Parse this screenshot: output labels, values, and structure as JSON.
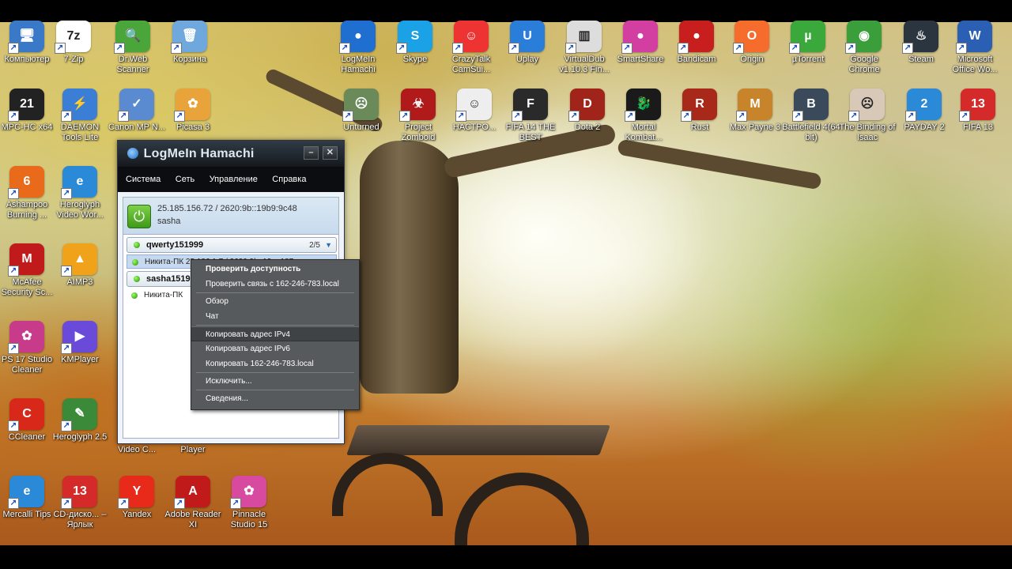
{
  "desktop_icons": [
    {
      "label": "Компьютер",
      "icon": "computer-icon",
      "color": "#3a78c8",
      "glyph": "🖥"
    },
    {
      "label": "7-Zip",
      "icon": "7zip-icon",
      "color": "#ffffff",
      "glyph": "7z"
    },
    {
      "label": "Dr.Web Scanner",
      "icon": "drweb-icon",
      "color": "#4aa53a",
      "glyph": "🔍"
    },
    {
      "label": "Корзина",
      "icon": "recycle-bin-icon",
      "color": "#6fa8dc",
      "glyph": "🗑"
    },
    {
      "label": "LogMeIn Hamachi",
      "icon": "hamachi-icon",
      "color": "#1f6fd1",
      "glyph": "●"
    },
    {
      "label": "Skype",
      "icon": "skype-icon",
      "color": "#1aa1e6",
      "glyph": "S"
    },
    {
      "label": "CrazyTalk CamSui...",
      "icon": "crazytalk-icon",
      "color": "#e33",
      "glyph": "☺"
    },
    {
      "label": "Uplay",
      "icon": "uplay-icon",
      "color": "#2a7ed9",
      "glyph": "U"
    },
    {
      "label": "VirtualDub v1.10.3 Fin...",
      "icon": "virtualdub-icon",
      "color": "#dddddd",
      "glyph": "▥"
    },
    {
      "label": "SmartShare",
      "icon": "smartshare-icon",
      "color": "#d33fa0",
      "glyph": "●"
    },
    {
      "label": "Bandicam",
      "icon": "bandicam-icon",
      "color": "#c81e1e",
      "glyph": "●"
    },
    {
      "label": "Origin",
      "icon": "origin-icon",
      "color": "#f56c2d",
      "glyph": "O"
    },
    {
      "label": "µTorrent",
      "icon": "utorrent-icon",
      "color": "#3aa83a",
      "glyph": "µ"
    },
    {
      "label": "Google Chrome",
      "icon": "chrome-icon",
      "color": "#3a9e3a",
      "glyph": "◉"
    },
    {
      "label": "Steam",
      "icon": "steam-icon",
      "color": "#2b3540",
      "glyph": "♨"
    },
    {
      "label": "Microsoft Office Wo...",
      "icon": "word-icon",
      "color": "#2b5fb4",
      "glyph": "W"
    },
    {
      "label": "MPC-HC x64",
      "icon": "mpc-icon",
      "color": "#222222",
      "glyph": "21"
    },
    {
      "label": "DAEMON Tools Lite",
      "icon": "daemon-tools-icon",
      "color": "#3a7ed6",
      "glyph": "⚡"
    },
    {
      "label": "Canon MP N...",
      "icon": "canon-icon",
      "color": "#5a8ad0",
      "glyph": "✓"
    },
    {
      "label": "Picasa 3",
      "icon": "picasa-icon",
      "color": "#e8a43a",
      "glyph": "✿"
    },
    {
      "label": "Unturned",
      "icon": "unturned-icon",
      "color": "#6a8a5a",
      "glyph": "☹"
    },
    {
      "label": "Project Zomboid",
      "icon": "zomboid-icon",
      "color": "#b01a1a",
      "glyph": "☣"
    },
    {
      "label": "НАСТРО...",
      "icon": "settings-app-icon",
      "color": "#eeeeee",
      "glyph": "☺"
    },
    {
      "label": "FIFA 14 THE BEST",
      "icon": "fifa14-icon",
      "color": "#2a2a2a",
      "glyph": "F"
    },
    {
      "label": "Dota 2",
      "icon": "dota2-icon",
      "color": "#a0241a",
      "glyph": "D"
    },
    {
      "label": "Mortal Kombat...",
      "icon": "mortal-kombat-icon",
      "color": "#1a1a1a",
      "glyph": "🐉"
    },
    {
      "label": "Rust",
      "icon": "rust-icon",
      "color": "#a8281a",
      "glyph": "R"
    },
    {
      "label": "Max Payne 3",
      "icon": "max-payne-icon",
      "color": "#c8842a",
      "glyph": "M"
    },
    {
      "label": "Battlefield 4(64 bit)",
      "icon": "battlefield-icon",
      "color": "#3a4a5a",
      "glyph": "B"
    },
    {
      "label": "The Binding of Isaac",
      "icon": "isaac-icon",
      "color": "#d8c8b8",
      "glyph": "☹"
    },
    {
      "label": "PAYDAY 2",
      "icon": "payday-icon",
      "color": "#2a8ad8",
      "glyph": "2"
    },
    {
      "label": "FIFA 13",
      "icon": "fifa13-icon",
      "color": "#d52a2a",
      "glyph": "13"
    },
    {
      "label": "Ashampoo Burning ...",
      "icon": "ashampoo-icon",
      "color": "#e86a1a",
      "glyph": "6"
    },
    {
      "label": "Heroglyph Video Wor...",
      "icon": "ie-icon",
      "color": "#2a8ad8",
      "glyph": "e"
    },
    {
      "label": "McAfee Security Sc...",
      "icon": "mcafee-icon",
      "color": "#c01a1a",
      "glyph": "M"
    },
    {
      "label": "AIMP3",
      "icon": "aimp-icon",
      "color": "#f0a21a",
      "glyph": "▲"
    },
    {
      "label": "PS 17 Studio Cleaner",
      "icon": "ps-cleaner-icon",
      "color": "#c83a8a",
      "glyph": "✿"
    },
    {
      "label": "KMPlayer",
      "icon": "kmplayer-icon",
      "color": "#6a4ad8",
      "glyph": "▶"
    },
    {
      "label": "CCleaner",
      "icon": "ccleaner-icon",
      "color": "#d8281a",
      "glyph": "C"
    },
    {
      "label": "Heroglyph 2.5",
      "icon": "heroglyph-icon",
      "color": "#3a8a3a",
      "glyph": "✎"
    },
    {
      "label": "Video C...",
      "icon": "video-converter-icon",
      "color": "#444444",
      "glyph": "▶"
    },
    {
      "label": "Player",
      "icon": "player-icon",
      "color": "#444444",
      "glyph": "▶"
    },
    {
      "label": "Mercalli Tips",
      "icon": "mercalli-icon",
      "color": "#2a8ad8",
      "glyph": "e"
    },
    {
      "label": "CD-диско... – Ярлык",
      "icon": "cd-drive-icon",
      "color": "#d52a2a",
      "glyph": "13"
    },
    {
      "label": "Yandex",
      "icon": "yandex-icon",
      "color": "#e82a1a",
      "glyph": "Y"
    },
    {
      "label": "Adobe Reader XI",
      "icon": "adobe-reader-icon",
      "color": "#c01a1a",
      "glyph": "A"
    },
    {
      "label": "Pinnacle Studio 15",
      "icon": "pinnacle-icon",
      "color": "#d84aa0",
      "glyph": "✿"
    }
  ],
  "hamachi": {
    "title": "LogMeIn Hamachi",
    "minimize": "–",
    "close": "✕",
    "menu": [
      "Система",
      "Сеть",
      "Управление",
      "Справка"
    ],
    "ip": "25.185.156.72 / 2620:9b::19b9:9c48",
    "username": "sasha",
    "networks": [
      {
        "name": "qwerty151999",
        "count": "2/5",
        "peer": "Никита-ПК   25.186.1.7 / 2620:9b::19...:187"
      },
      {
        "name": "sasha1519",
        "peer": "Никита-ПК"
      }
    ]
  },
  "context_menu": [
    {
      "label": "Проверить доступность",
      "bold": true
    },
    {
      "label": "Проверить связь с 162-246-783.local"
    },
    {
      "sep": true
    },
    {
      "label": "Обзор"
    },
    {
      "label": "Чат"
    },
    {
      "sep": true
    },
    {
      "label": "Копировать адрес IPv4",
      "highlighted": true
    },
    {
      "label": "Копировать адрес IPv6"
    },
    {
      "label": "Копировать 162-246-783.local"
    },
    {
      "sep": true
    },
    {
      "label": "Исключить..."
    },
    {
      "sep": true
    },
    {
      "label": "Сведения..."
    }
  ]
}
